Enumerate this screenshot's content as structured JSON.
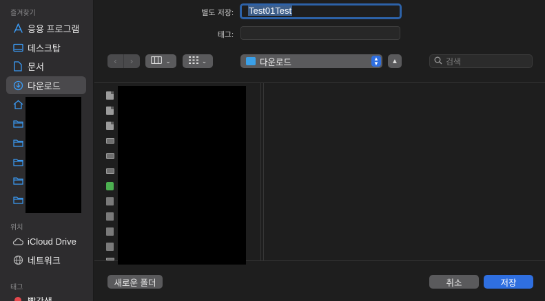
{
  "sidebar": {
    "favorites_header": "즐겨찾기",
    "favorites": [
      {
        "label": "응용 프로그램",
        "icon": "applications-icon"
      },
      {
        "label": "데스크탑",
        "icon": "desktop-icon"
      },
      {
        "label": "문서",
        "icon": "document-icon"
      },
      {
        "label": "다운로드",
        "icon": "downloads-icon",
        "active": true
      },
      {
        "label": "",
        "icon": "home-icon"
      },
      {
        "label": "",
        "icon": "folder-icon"
      },
      {
        "label": "",
        "icon": "folder-icon"
      },
      {
        "label": "",
        "icon": "folder-icon"
      },
      {
        "label": "",
        "icon": "folder-icon"
      },
      {
        "label": "",
        "icon": "folder-icon"
      }
    ],
    "locations_header": "위치",
    "locations": [
      {
        "label": "iCloud Drive",
        "icon": "cloud-icon"
      },
      {
        "label": "네트워크",
        "icon": "globe-icon"
      }
    ],
    "tags_header": "태그",
    "tags": [
      {
        "label": "빨간색",
        "color": "#e5484d"
      }
    ]
  },
  "form": {
    "save_as_label": "별도 저장:",
    "save_as_value": "Test01Test",
    "tags_label": "태그:",
    "tags_value": ""
  },
  "toolbar": {
    "location": "다운로드",
    "search_placeholder": "검색"
  },
  "footer": {
    "new_folder": "새로운 폴더",
    "cancel": "취소",
    "save": "저장"
  },
  "colors": {
    "accent": "#2f6fe0",
    "focus_ring": "#2d62a8"
  }
}
